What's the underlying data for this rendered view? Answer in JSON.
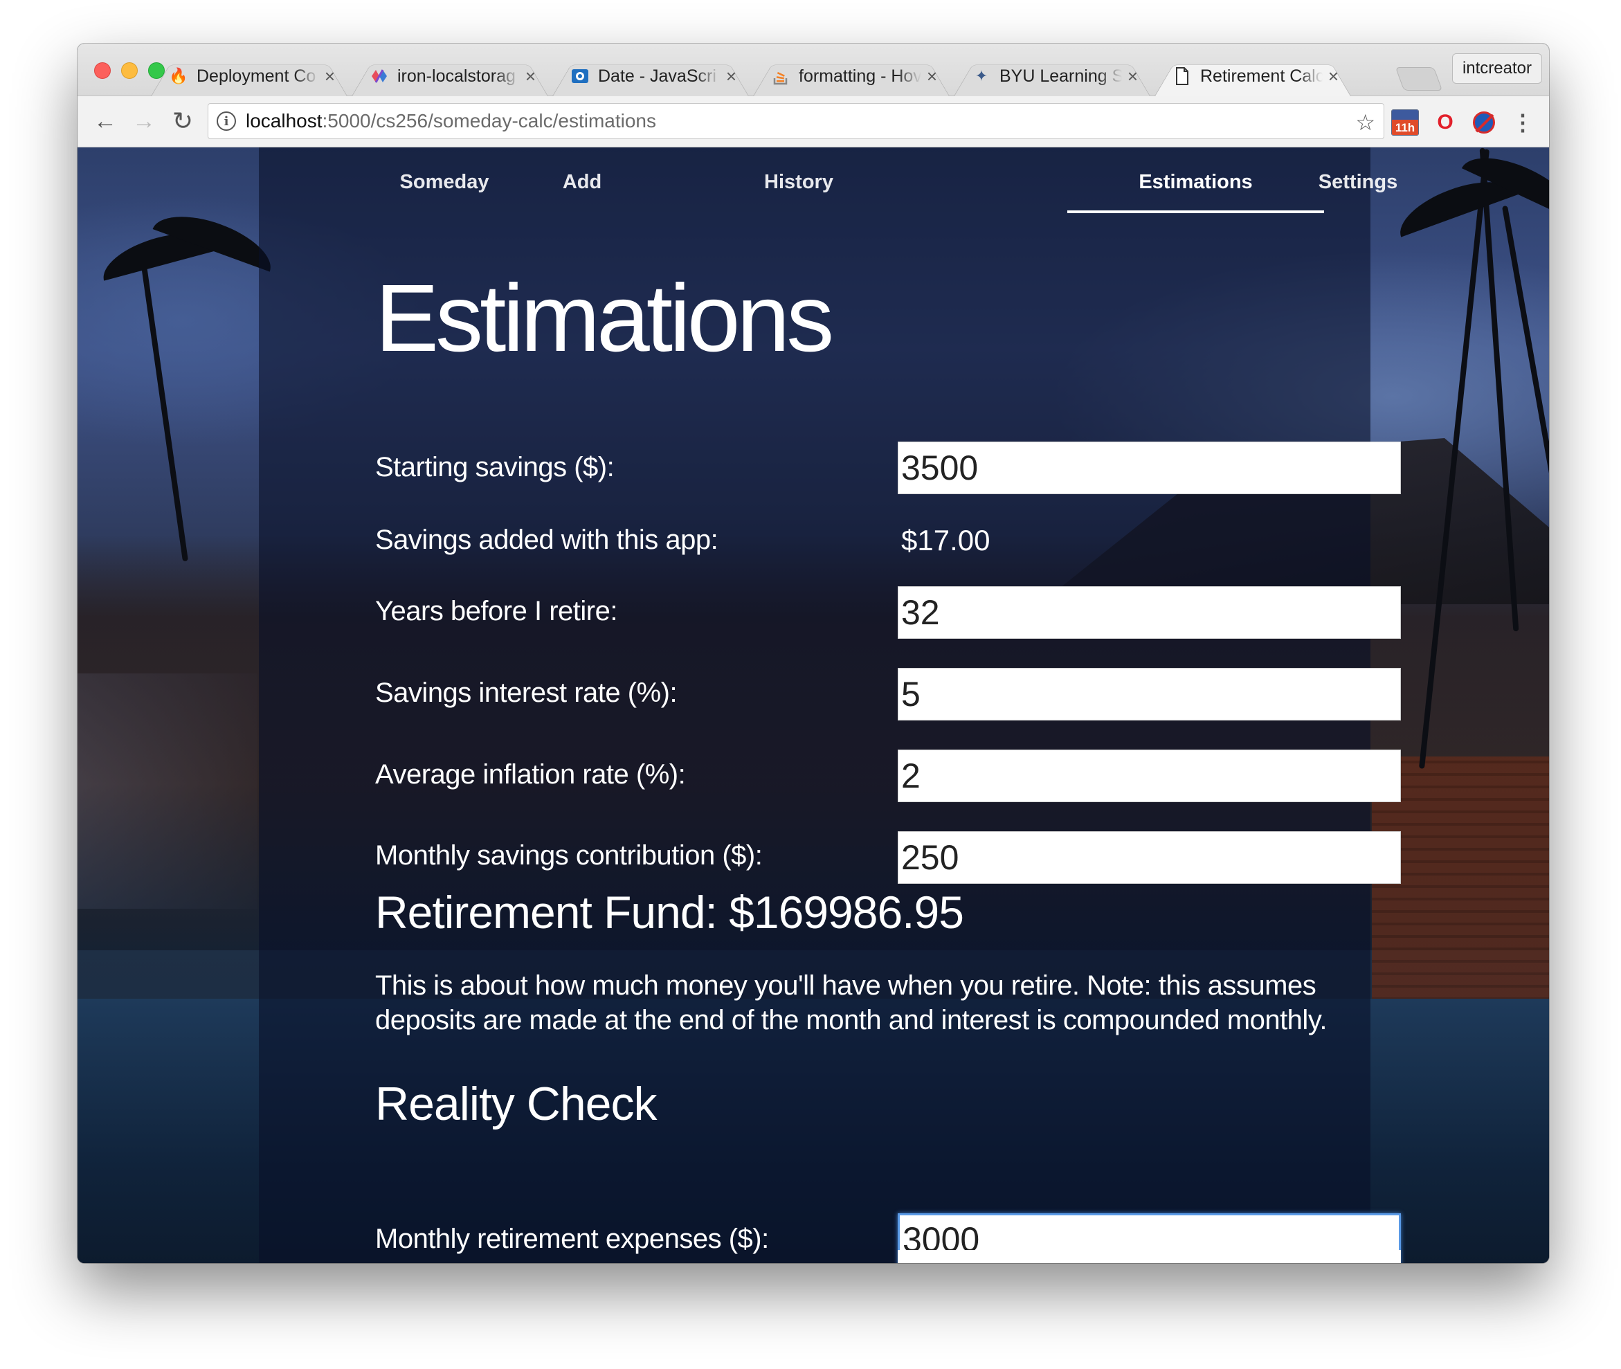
{
  "browser": {
    "tabs": [
      {
        "title": "Deployment Co",
        "icon": "firebase-icon",
        "active": false
      },
      {
        "title": "iron-localstorag",
        "icon": "polymer-icon",
        "active": false
      },
      {
        "title": "Date - JavaScri",
        "icon": "mdn-icon",
        "active": false
      },
      {
        "title": "formatting - Hov",
        "icon": "stackoverflow-icon",
        "active": false
      },
      {
        "title": "BYU Learning S",
        "icon": "byu-learning-icon",
        "active": false
      },
      {
        "title": "Retirement Calc",
        "icon": "document-icon",
        "active": true
      }
    ],
    "profile_name": "intcreator",
    "url_host": "localhost",
    "url_path": ":5000/cs256/someday-calc/estimations",
    "extension_badge": "11h"
  },
  "nav": {
    "items": [
      {
        "label": "Someday",
        "active": false
      },
      {
        "label": "Add",
        "active": false
      },
      {
        "label": "History",
        "active": false
      },
      {
        "label": "Estimations",
        "active": true
      },
      {
        "label": "Settings",
        "active": false
      }
    ]
  },
  "page": {
    "title": "Estimations",
    "fields": {
      "starting_savings": {
        "label": "Starting savings ($):",
        "value": "3500"
      },
      "savings_added": {
        "label": "Savings added with this app:",
        "value": "$17.00"
      },
      "years_before_retire": {
        "label": "Years before I retire:",
        "value": "32"
      },
      "interest_rate": {
        "label": "Savings interest rate (%):",
        "value": "5"
      },
      "inflation_rate": {
        "label": "Average inflation rate (%):",
        "value": "2"
      },
      "monthly_contribution": {
        "label": "Monthly savings contribution ($):",
        "value": "250"
      }
    },
    "fund_heading": "Retirement Fund: $169986.95",
    "fund_note": "This is about how much money you'll have when you retire. Note: this assumes deposits are made at the end of the month and interest is compounded monthly.",
    "reality_heading": "Reality Check",
    "reality_fields": {
      "monthly_expenses": {
        "label": "Monthly retirement expenses ($):",
        "value": "3000"
      }
    }
  }
}
